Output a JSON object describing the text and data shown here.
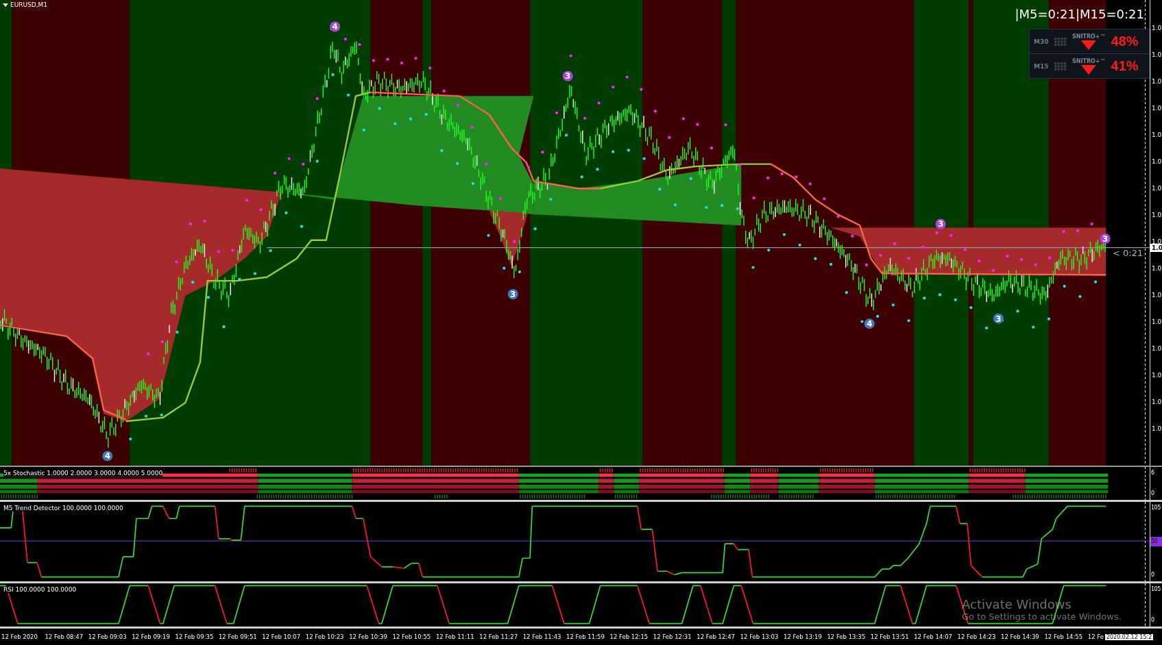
{
  "chart": {
    "symbol": "EURUSD,M1",
    "timer": "|M5=0:21|M15=0:21",
    "candle_timer": "< 0:21",
    "current_price": "1.0",
    "price_axis": [
      "1.0",
      "1.0",
      "1.0",
      "1.0",
      "1.0",
      "1.0",
      "1.0",
      "1.0",
      "1.0",
      "1.0",
      "1.0",
      "1.0",
      "1.0",
      "1.0",
      "1.0",
      "1.0"
    ],
    "wave_marks": [
      {
        "label": "4",
        "color": "#a944d4"
      },
      {
        "label": "3",
        "color": "#a944d4"
      },
      {
        "label": "3",
        "color": "#3f78b8"
      },
      {
        "label": "4",
        "color": "#3f78b8"
      },
      {
        "label": "4",
        "color": "#3f78b8"
      },
      {
        "label": "3",
        "color": "#a944d4"
      },
      {
        "label": "3",
        "color": "#3f78b8"
      },
      {
        "label": "3",
        "color": "#a944d4"
      }
    ]
  },
  "signal_panel": {
    "rows": [
      {
        "timeframe": "M30",
        "brand": "SNITRO+™",
        "kind": "down",
        "percent": "48%"
      },
      {
        "timeframe": "M15",
        "brand": "SNITRO+™",
        "kind": "down",
        "percent": "41%"
      }
    ]
  },
  "indicators": [
    {
      "kind": "stochastic",
      "label": "5x Stochastic 1.0000 2.0000 3.0000 4.0000 5.0000",
      "axis": [
        "6",
        "0"
      ]
    },
    {
      "kind": "trend",
      "label": "M5 Trend Detector 100.0000 100.0000",
      "axis": [
        "105",
        "50",
        "0"
      ]
    },
    {
      "kind": "rsi",
      "label": "RSI 100.0000 100.0000",
      "axis": [
        "105",
        "0"
      ]
    }
  ],
  "time_axis": {
    "labels": [
      "12 Feb 2020",
      "12 Feb 08:47",
      "12 Feb 09:03",
      "12 Feb 09:19",
      "12 Feb 09:35",
      "12 Feb 09:51",
      "12 Feb 10:07",
      "12 Feb 10:23",
      "12 Feb 10:39",
      "12 Feb 10:55",
      "12 Feb 11:11",
      "12 Feb 11:27",
      "12 Feb 11:43",
      "12 Feb 11:59",
      "12 Feb 12:15",
      "12 Feb 12:31",
      "12 Feb 12:47",
      "12 Feb 13:03",
      "12 Feb 13:19",
      "12 Feb 13:35",
      "12 Feb 13:51",
      "12 Feb 14:07",
      "12 Feb 14:23",
      "12 Feb 14:39",
      "12 Feb 14:55",
      "12 Fe"
    ],
    "cursor_time": "2020.02.12 15:2"
  },
  "os_notice": {
    "title": "Activate Windows",
    "message": "Go to Settings to activate Windows."
  }
}
